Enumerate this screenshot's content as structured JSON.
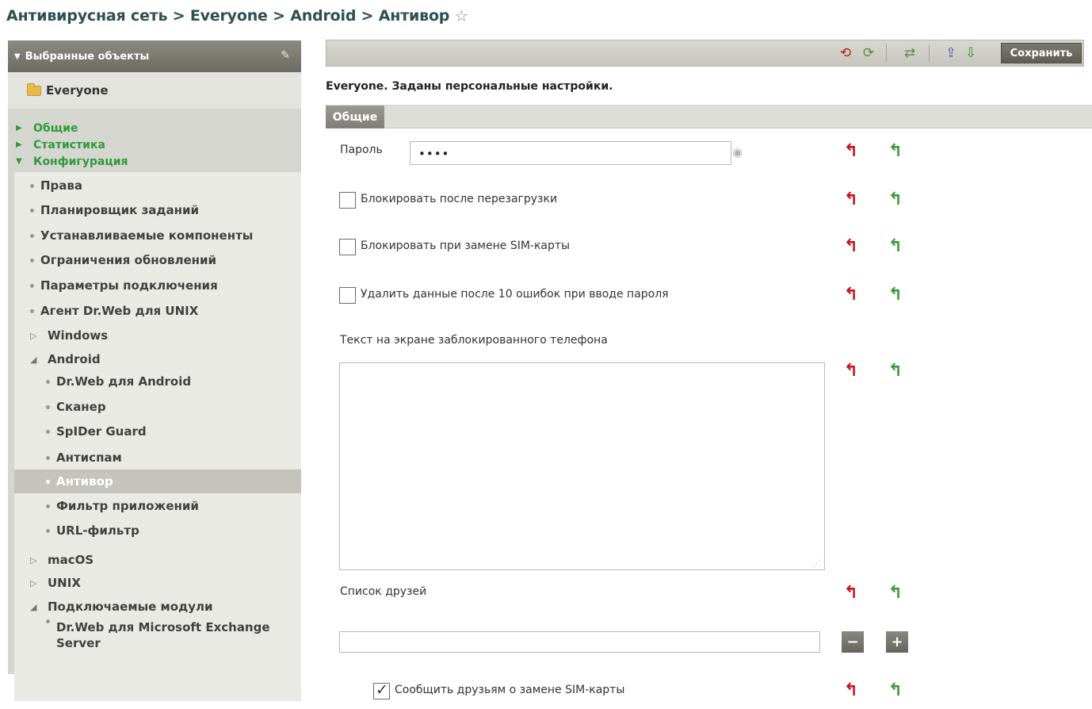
{
  "breadcrumb": {
    "text": "Антивирусная сеть > Everyone > Android > Антивор",
    "star": "☆"
  },
  "sidebar": {
    "header": "Выбранные объекты",
    "root_label": "Everyone",
    "sections": [
      "Общие",
      "Статистика",
      "Конфигурация"
    ],
    "items": [
      {
        "label": "Права",
        "kind": "bullet",
        "indent": 0
      },
      {
        "label": "Планировщик заданий",
        "kind": "bullet",
        "indent": 0
      },
      {
        "label": "Устанавливаемые компоненты",
        "kind": "bullet",
        "indent": 0
      },
      {
        "label": "Ограничения обновлений",
        "kind": "bullet",
        "indent": 0
      },
      {
        "label": "Параметры подключения",
        "kind": "bullet",
        "indent": 0
      },
      {
        "label": "Агент Dr.Web для UNIX",
        "kind": "bullet",
        "indent": 0
      },
      {
        "label": "Windows",
        "kind": "collapsed",
        "indent": 0
      },
      {
        "label": "Android",
        "kind": "expanded",
        "indent": 0
      },
      {
        "label": "Dr.Web для Android",
        "kind": "bullet",
        "indent": 1
      },
      {
        "label": "Сканер",
        "kind": "bullet",
        "indent": 1
      },
      {
        "label": "SpIDer Guard",
        "kind": "bullet",
        "indent": 1
      },
      {
        "label": "Антиспам",
        "kind": "bullet",
        "indent": 1
      },
      {
        "label": "Антивор",
        "kind": "bullet",
        "indent": 1,
        "selected": true
      },
      {
        "label": "Фильтр приложений",
        "kind": "bullet",
        "indent": 1
      },
      {
        "label": "URL-фильтр",
        "kind": "bullet",
        "indent": 1
      },
      {
        "label": "macOS",
        "kind": "collapsed",
        "indent": 0
      },
      {
        "label": "UNIX",
        "kind": "collapsed",
        "indent": 0
      },
      {
        "label": "Подключаемые модули",
        "kind": "expanded",
        "indent": 0
      },
      {
        "label": "Dr.Web для Microsoft Exchange Server",
        "kind": "bullet",
        "indent": 1
      }
    ]
  },
  "toolbar": {
    "save_label": "Сохранить"
  },
  "info_text": "Everyone. Заданы персональные настройки.",
  "tab_label": "Общие",
  "form": {
    "password_label": "Пароль",
    "password_value": "••••",
    "lock_after_reboot": "Блокировать после перезагрузки",
    "lock_on_sim_change": "Блокировать при замене SIM-карты",
    "wipe_after_errors": "Удалить данные после 10 ошибок при вводе пароля",
    "lock_screen_text_label": "Текст на экране заблокированного телефона",
    "friends_list_label": "Список друзей",
    "notify_friends": "Сообщить друзьям о замене SIM-карты",
    "minus": "−",
    "plus": "+"
  },
  "colors": {
    "accent_green": "#2f9a3a",
    "reset_red": "#c8141e",
    "reset_green": "#3a9a34"
  }
}
